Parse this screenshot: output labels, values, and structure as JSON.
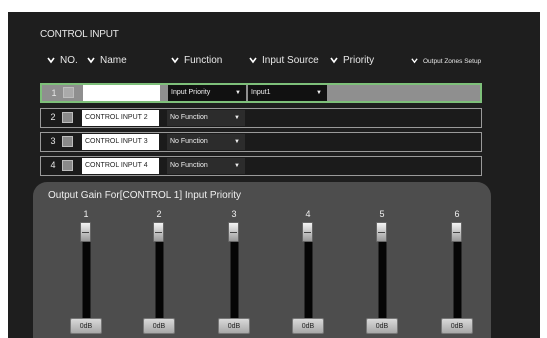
{
  "title": "CONTROL INPUT",
  "headers": {
    "no": "NO.",
    "name": "Name",
    "function": "Function",
    "input_source": "Input Source",
    "priority": "Priority",
    "output_zones": "Output Zones Setup"
  },
  "rows": [
    {
      "num": "1",
      "name": "",
      "function": "Input Priority",
      "input_source": "Input1"
    },
    {
      "num": "2",
      "name": "CONTROL INPUT 2",
      "function": "No Function"
    },
    {
      "num": "3",
      "name": "CONTROL INPUT 3",
      "function": "No Function"
    },
    {
      "num": "4",
      "name": "CONTROL INPUT 4",
      "function": "No Function"
    }
  ],
  "gain": {
    "title": "Output Gain For[CONTROL 1] Input Priority",
    "channels": [
      {
        "label": "1",
        "value": "0dB"
      },
      {
        "label": "2",
        "value": "0dB"
      },
      {
        "label": "3",
        "value": "0dB"
      },
      {
        "label": "4",
        "value": "0dB"
      },
      {
        "label": "5",
        "value": "0dB"
      },
      {
        "label": "6",
        "value": "0dB"
      }
    ]
  },
  "icons": {
    "chevron": "chevron-down-icon",
    "dropdown_arrow": "caret-down-icon"
  }
}
